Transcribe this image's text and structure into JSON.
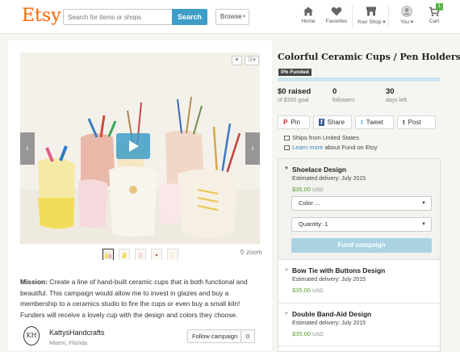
{
  "header": {
    "logo": "Etsy",
    "search_placeholder": "Search for items or shops",
    "search_button": "Search",
    "browse": "Browse",
    "nav": [
      {
        "label": "Home",
        "icon": "home-icon"
      },
      {
        "label": "Favorites",
        "icon": "heart-icon"
      },
      {
        "label": "Your Shop",
        "icon": "shop-icon",
        "caret": "▾"
      },
      {
        "label": "You",
        "icon": "avatar-icon",
        "caret": "▾"
      },
      {
        "label": "Cart",
        "icon": "cart-icon",
        "badge": "1"
      }
    ]
  },
  "media": {
    "prev_arrow": "‹",
    "next_arrow": "›",
    "zoom_label": "zoom",
    "thumbnail_count": 5
  },
  "campaign": {
    "title": "Colorful Ceramic Cups / Pen Holders!",
    "funded_badge": "0% Funded",
    "funded_fraction": 0,
    "stats": [
      {
        "value": "$0 raised",
        "label": "of $350 goal"
      },
      {
        "value": "0",
        "label": "followers"
      },
      {
        "value": "30",
        "label": "days left"
      }
    ],
    "share": [
      {
        "glyph": "P",
        "label": "Pin"
      },
      {
        "glyph": "f",
        "label": "Share"
      },
      {
        "glyph": "t",
        "label": "Tweet"
      },
      {
        "glyph": "t",
        "label": "Post"
      }
    ],
    "ships_from": "Ships from United States",
    "learn_more_link": "Learn more",
    "learn_more_rest": " about Fund on Etsy",
    "mission_label": "Mission:",
    "mission_text": " Create a line of hand-built ceramic cups that is both functional and beautiful. This campaign would allow me to invest in glazes and buy a membership to a ceramics studio to fire the cups or even buy a small kiln! Funders will receive a lovely cup with the design and colors they choose.",
    "creator": {
      "monogram": "KH",
      "name": "KattysHandcrafts",
      "location": "Miami, Florida"
    },
    "follow_label": "Follow campaign",
    "follow_count": "0"
  },
  "rewards": [
    {
      "name": "Shoelace Design",
      "delivery": "Estimated delivery: July 2015",
      "price": "$35.00",
      "currency": "USD",
      "expanded": true
    },
    {
      "name": "Bow Tie with Buttons Design",
      "delivery": "Estimated delivery: July 2015",
      "price": "$35.00",
      "currency": "USD",
      "expanded": false
    },
    {
      "name": "Double Band-Aid Design",
      "delivery": "Estimated delivery: July 2015",
      "price": "$35.00",
      "currency": "USD",
      "expanded": false
    }
  ],
  "reward_form": {
    "color_select": "Color ...",
    "quantity_select": "Quantity: 1",
    "fund_button": "Fund campaign"
  }
}
